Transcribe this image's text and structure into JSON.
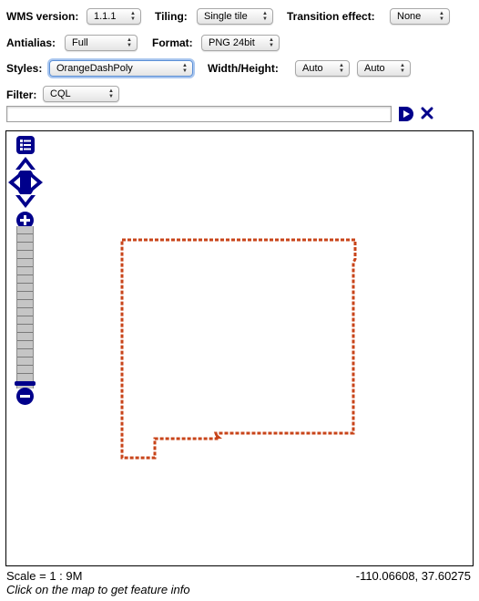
{
  "toolbar": {
    "wms_version": {
      "label": "WMS version:",
      "value": "1.1.1"
    },
    "tiling": {
      "label": "Tiling:",
      "value": "Single tile"
    },
    "transition": {
      "label": "Transition effect:",
      "value": "None"
    },
    "antialias": {
      "label": "Antialias:",
      "value": "Full"
    },
    "format": {
      "label": "Format:",
      "value": "PNG 24bit"
    },
    "styles": {
      "label": "Styles:",
      "value": "OrangeDashPoly"
    },
    "width_height": {
      "label": "Width/Height:",
      "width_value": "Auto",
      "height_value": "Auto"
    },
    "filter": {
      "label": "Filter:",
      "value": "CQL",
      "expression": ""
    }
  },
  "map": {
    "style_color": "#c8441a",
    "controls": {
      "layer_switcher_icon": "layer-switcher-icon",
      "pan_icon": "pan-arrows-icon",
      "zoom_in_icon": "zoom-in-icon",
      "zoom_out_icon": "zoom-out-icon"
    }
  },
  "footer": {
    "scale": "Scale = 1 : 9M",
    "coordinates": "-110.06608, 37.60275",
    "hint": "Click on the map to get feature info"
  },
  "colors": {
    "control_blue": "#00008b",
    "polygon": "#c8441a"
  }
}
